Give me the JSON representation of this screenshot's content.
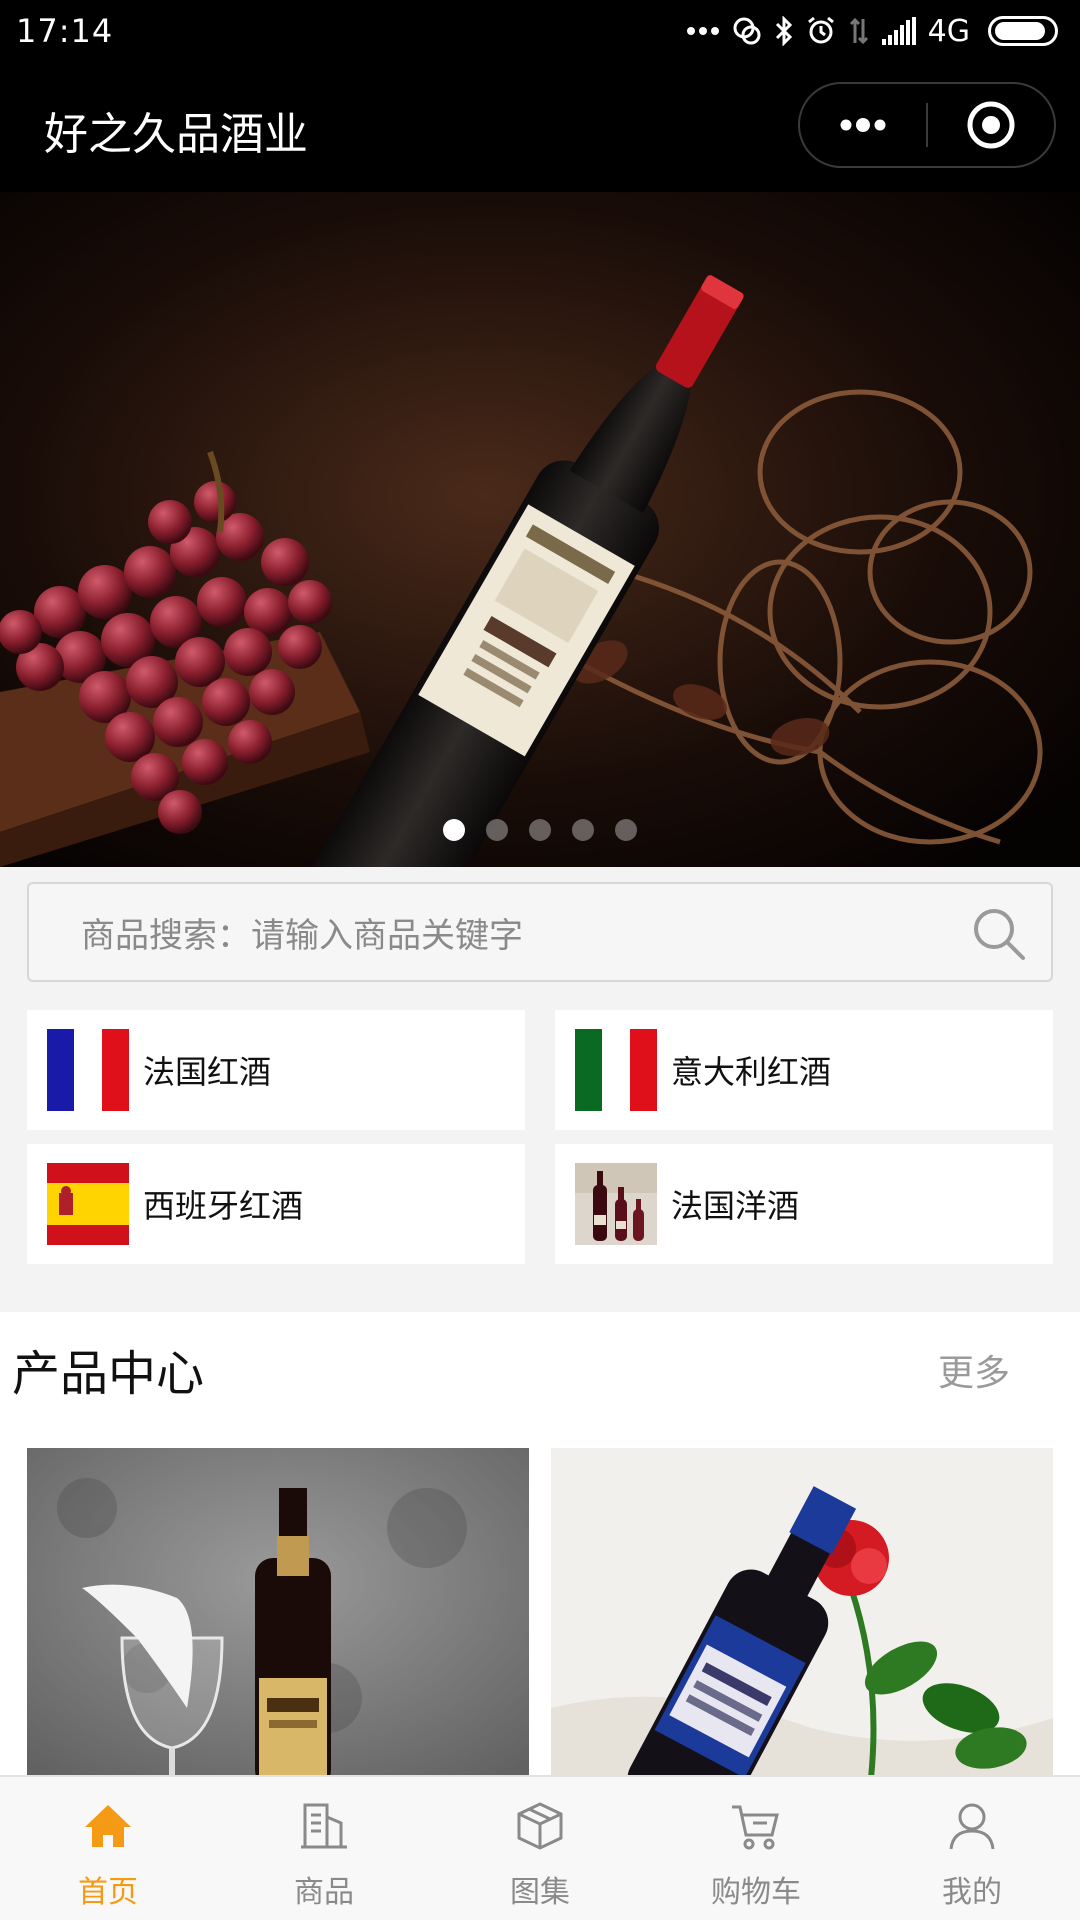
{
  "status_bar": {
    "time": "17:14",
    "network": "4G",
    "battery_level": 0.9
  },
  "navbar": {
    "title": "好之久品酒业"
  },
  "banner": {
    "slide_count": 5,
    "active_index": 0
  },
  "search": {
    "placeholder": "商品搜索：请输入商品关键字"
  },
  "categories": [
    {
      "label": "法国红酒",
      "icon": "france-flag-icon"
    },
    {
      "label": "意大利红酒",
      "icon": "italy-flag-icon"
    },
    {
      "label": "西班牙红酒",
      "icon": "spain-flag-icon"
    },
    {
      "label": "法国洋酒",
      "icon": "wine-bottles-icon"
    }
  ],
  "product_section": {
    "title": "产品中心",
    "more": "更多"
  },
  "tabbar": {
    "items": [
      {
        "label": "首页",
        "icon": "home-icon",
        "active": true
      },
      {
        "label": "商品",
        "icon": "building-icon",
        "active": false
      },
      {
        "label": "图集",
        "icon": "box-icon",
        "active": false
      },
      {
        "label": "购物车",
        "icon": "cart-icon",
        "active": false
      },
      {
        "label": "我的",
        "icon": "user-icon",
        "active": false
      }
    ]
  },
  "colors": {
    "accent": "#f59a14",
    "inactive": "#8a8a8a"
  }
}
